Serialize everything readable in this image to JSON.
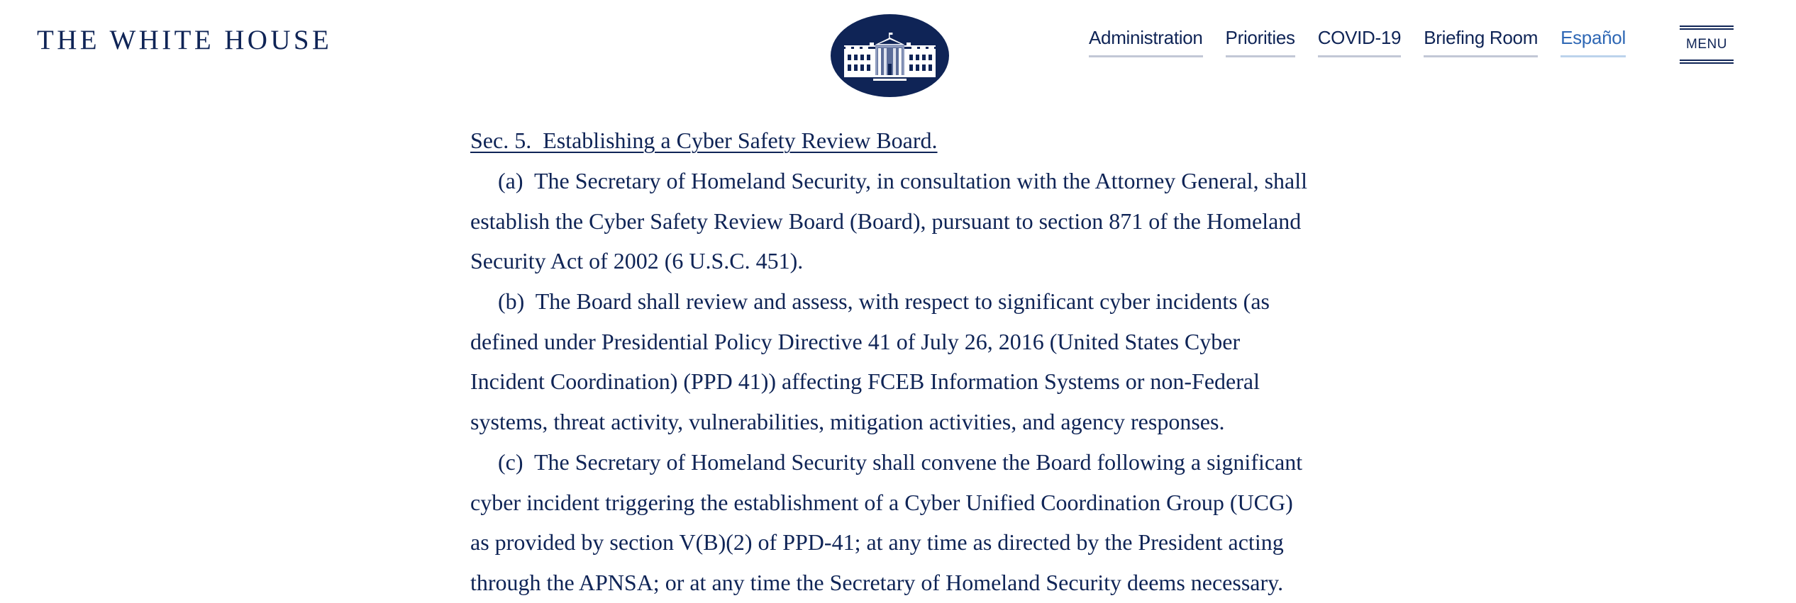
{
  "header": {
    "site_title": "THE WHITE HOUSE",
    "seal_icon": "white-house-seal",
    "nav": [
      {
        "label": "Administration"
      },
      {
        "label": "Priorities"
      },
      {
        "label": "COVID-19"
      },
      {
        "label": "Briefing Room"
      },
      {
        "label": "Español"
      }
    ],
    "menu_label": "MENU",
    "colors": {
      "brand_navy": "#0f2456",
      "language_link": "#2f68b5"
    }
  },
  "article": {
    "section_heading": "Sec. 5.  Establishing a Cyber Safety Review Board.",
    "paragraphs": [
      {
        "lines": [
          "(a)  The Secretary of Homeland Security, in consultation with the Attorney General, shall",
          "establish the Cyber Safety Review Board (Board), pursuant to section 871 of the Homeland",
          "Security Act of 2002 (6 U.S.C. 451)."
        ]
      },
      {
        "lines": [
          "(b)  The Board shall review and assess, with respect to significant cyber incidents (as",
          "defined under Presidential Policy Directive 41 of July 26, 2016 (United States Cyber",
          "Incident Coordination) (PPD 41)) affecting FCEB Information Systems or non-Federal",
          "systems, threat activity, vulnerabilities, mitigation activities, and agency responses."
        ]
      },
      {
        "lines": [
          "(c)  The Secretary of Homeland Security shall convene the Board following a significant",
          "cyber incident triggering the establishment of a Cyber Unified Coordination Group (UCG)",
          "as provided by section V(B)(2) of PPD-41; at any time as directed by the President acting",
          "through the APNSA; or at any time the Secretary of Homeland Security deems necessary."
        ]
      }
    ]
  }
}
